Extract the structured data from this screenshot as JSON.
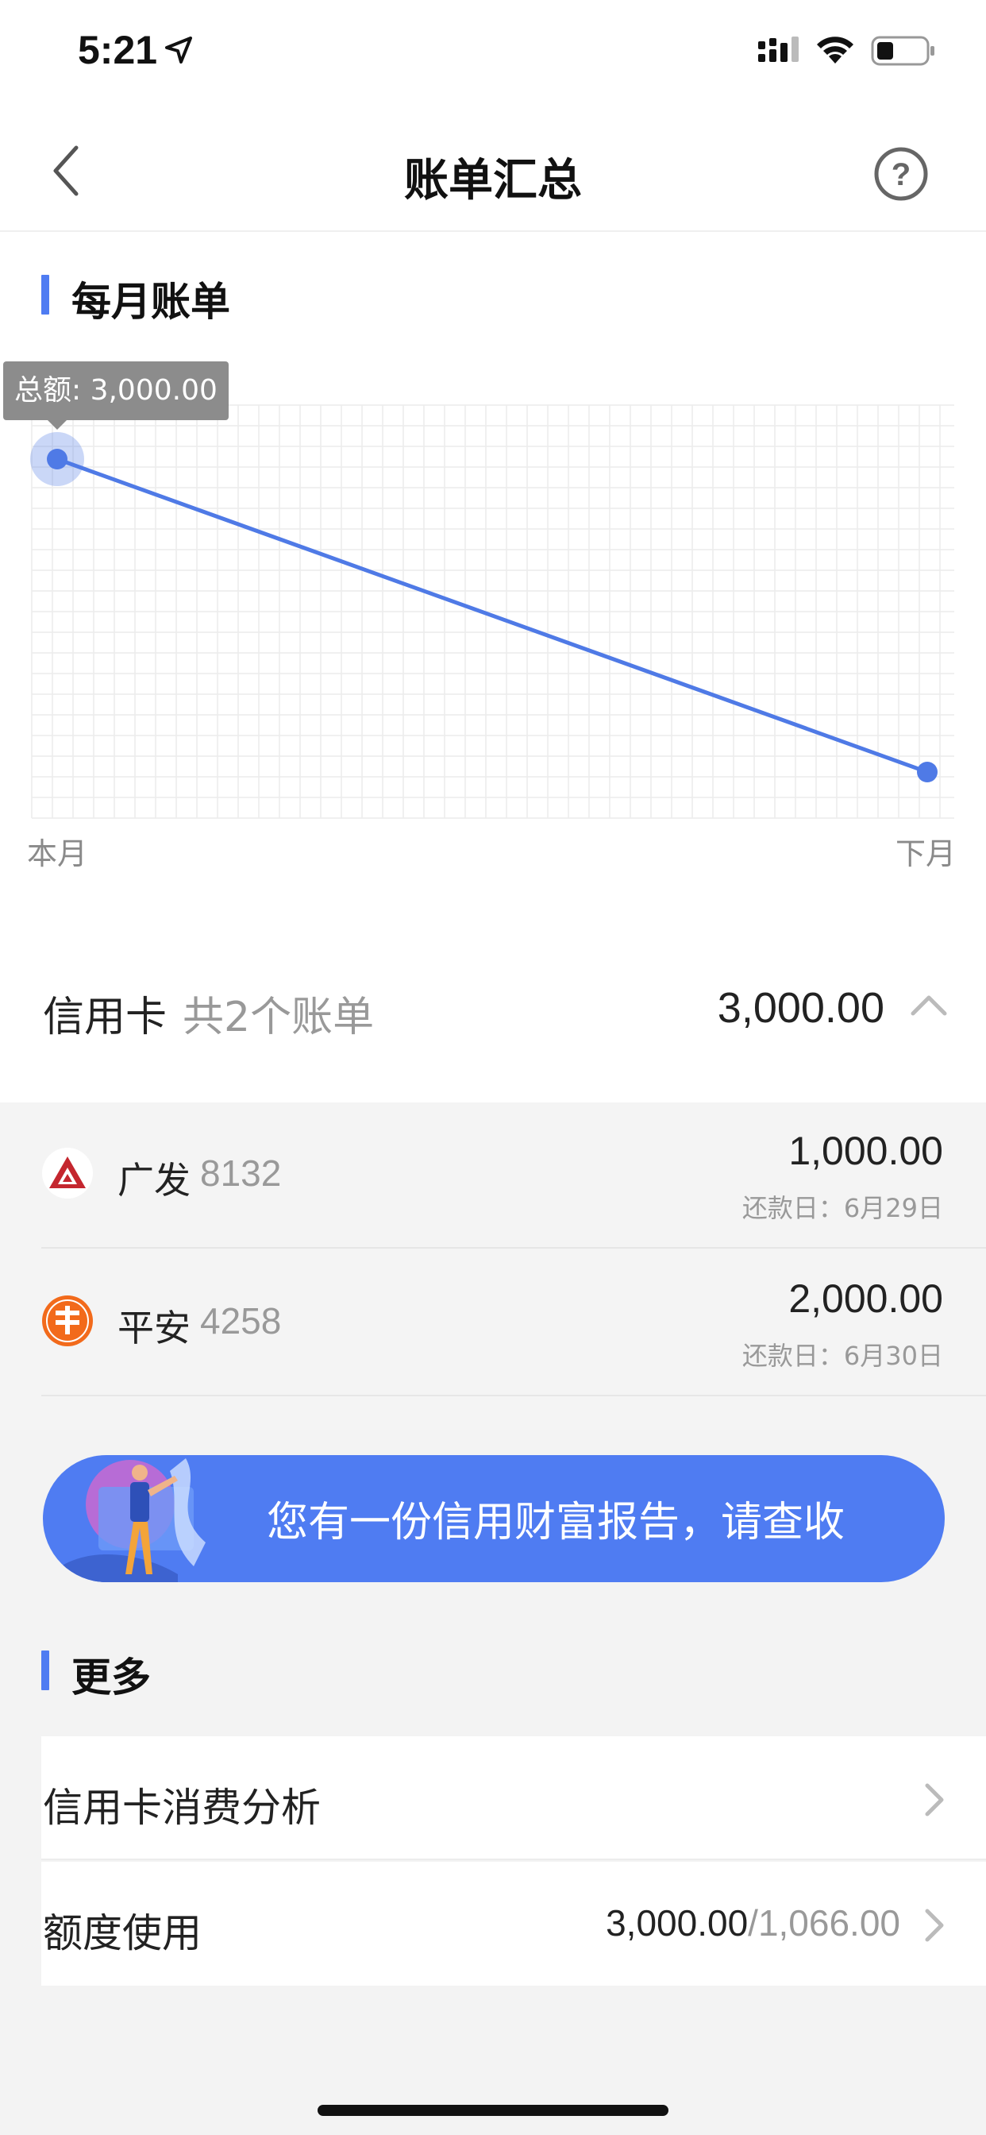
{
  "status_bar": {
    "time": "5:21"
  },
  "nav": {
    "title": "账单汇总"
  },
  "monthly": {
    "section_title": "每月账单",
    "tooltip": "总额: 3,000.00"
  },
  "chart_data": {
    "type": "line",
    "categories": [
      "本月",
      "下月"
    ],
    "series": [
      {
        "values": [
          3000,
          0
        ]
      }
    ],
    "title": "",
    "xlabel": "",
    "ylabel": "",
    "grid": true
  },
  "credit": {
    "label": "信用卡",
    "count": "共2个账单",
    "total": "3,000.00",
    "cards": [
      {
        "bank": "广发",
        "number": "8132",
        "amount": "1,000.00",
        "due": "还款日：6月29日"
      },
      {
        "bank": "平安",
        "number": "4258",
        "amount": "2,000.00",
        "due": "还款日：6月30日"
      }
    ]
  },
  "banner": {
    "text": "您有一份信用财富报告，请查收"
  },
  "more": {
    "section_title": "更多",
    "items": [
      {
        "label": "信用卡消费分析"
      },
      {
        "label": "额度使用",
        "used": "3,000.00",
        "separator": "/",
        "limit": "1,066.00"
      }
    ]
  },
  "colors": {
    "accent": "#4f7cf2",
    "line": "#4f7ae6"
  }
}
